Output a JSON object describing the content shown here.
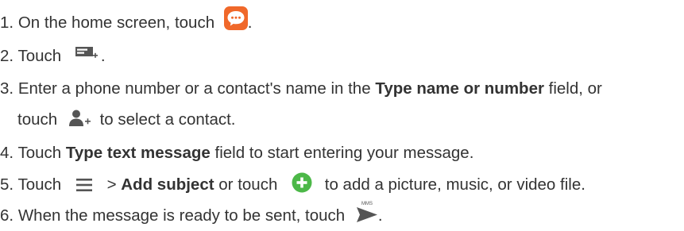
{
  "steps": [
    {
      "number": "1.",
      "text_before": "On the home screen, touch",
      "text_after": ".",
      "icon": "messaging-app-icon"
    },
    {
      "number": "2.",
      "text_before": "Touch",
      "text_after": ".",
      "icon": "new-message-icon"
    },
    {
      "number": "3.",
      "text_before": "Enter a phone number or a contact's name in the",
      "bold": "Type name or number",
      "text_after": "field, or",
      "continuation_before": "touch",
      "continuation_after": "to select a contact.",
      "icon": "add-contact-icon"
    },
    {
      "number": "4.",
      "text_before": "Touch",
      "bold": "Type text message",
      "text_after": "field to start entering your message."
    },
    {
      "number": "5.",
      "text_before": "Touch",
      "separator": ">",
      "bold": "Add subject",
      "text_middle": "or touch",
      "text_after": "to add a picture, music, or video file.",
      "icons": [
        "menu-icon",
        "add-attachment-icon"
      ]
    },
    {
      "number": "6.",
      "text_before": "When the message is ready to be sent, touch",
      "text_after": ".",
      "icon": "send-mms-icon",
      "icon_label": "MMS"
    }
  ],
  "colors": {
    "text": "#333333",
    "messaging_icon": "#F0682A",
    "add_attachment_icon": "#4CB848",
    "icon_gray": "#555555"
  }
}
